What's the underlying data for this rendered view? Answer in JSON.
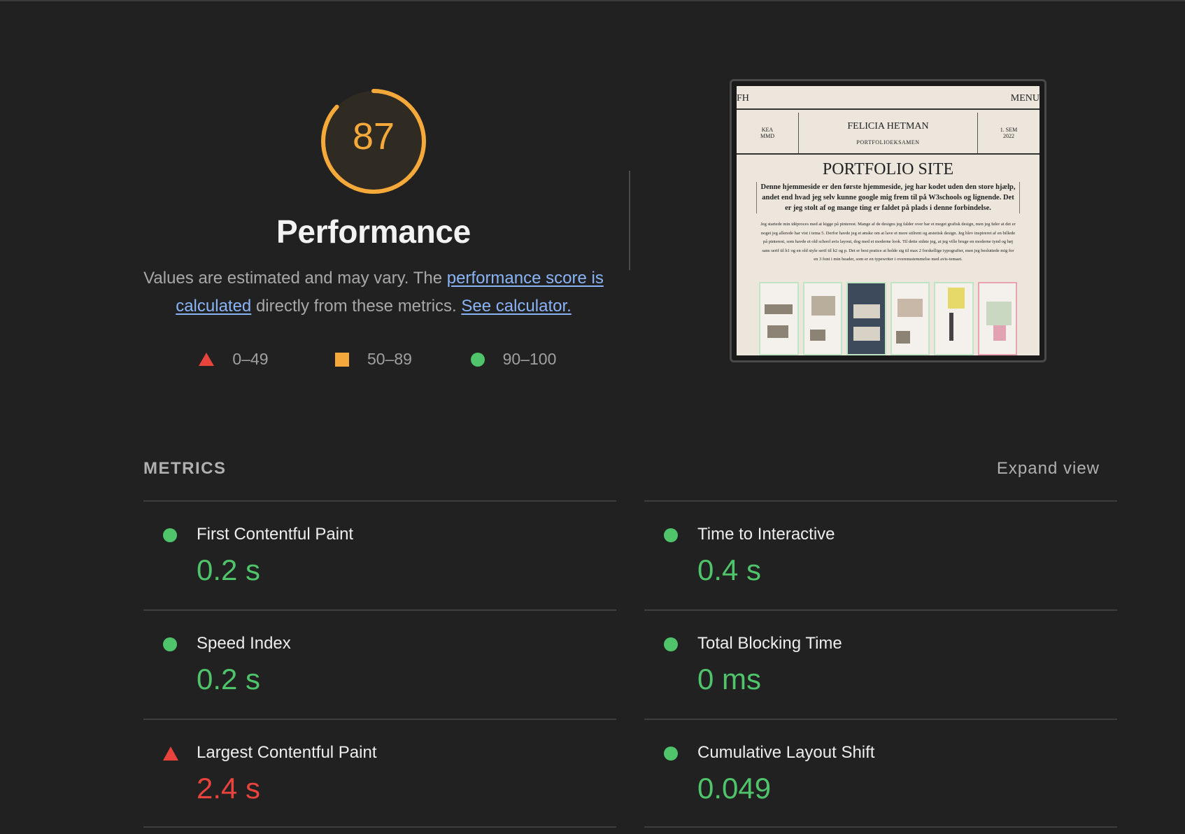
{
  "gauge": {
    "score": "87",
    "score_fraction": 0.87,
    "title": "Performance",
    "desc_prefix": "Values are estimated and may vary. The",
    "link_score": "performance score is calculated",
    "desc_middle": "directly from these metrics.",
    "link_calculator": "See calculator.",
    "color": "#f5a93a"
  },
  "legend": [
    {
      "shape": "triangle",
      "label": "0–49",
      "color": "#e8443d"
    },
    {
      "shape": "square",
      "label": "50–89",
      "color": "#f5a93a"
    },
    {
      "shape": "circle",
      "label": "90–100",
      "color": "#4fc46b"
    }
  ],
  "screenshot": {
    "nav_left": "FH",
    "nav_right": "MENU",
    "left_meta": "KEA\nMMD",
    "name": "FELICIA HETMAN",
    "subtitle": "PORTFOLIOEKSAMEN",
    "right_meta": "1. SEM\n2022",
    "title": "PORTFOLIO SITE",
    "lead": "Denne hjemmeside er den første hjemmeside, jeg har kodet uden den store hjælp, andet end hvad jeg selv kunne google mig frem til på W3schools og lignende. Det er jeg stolt af og mange ting er faldet på plads i denne forbindelse.",
    "body": "Jeg startede min idéproces med at kigge på pinterest. Mange af de designs jeg falder over har et meget grafisk design, men jeg føler at det er noget jeg allerede har vist i tema 5. Derfor havde jeg et ønske om at lave et mere stilrent og æstetisk design. Jeg blev inspireret af en billede på pinterest, som havde et old school avis layout, dog med et moderne look. Til dette sidste jeg, at jeg ville bruge en moderne tynd og høj sans serif til h1 og en old style serif til h2 og p. Det er best pratice at holde sig til max 2 forskellige typografier, men jeg besluttede mig for en 3 font i min header, som er en typewriter i overensstemmelse med avis-temaet."
  },
  "metrics": {
    "label": "METRICS",
    "expand_label": "Expand view",
    "items": [
      {
        "name": "First Contentful Paint",
        "value": "0.2 s",
        "status": "good"
      },
      {
        "name": "Time to Interactive",
        "value": "0.4 s",
        "status": "good"
      },
      {
        "name": "Speed Index",
        "value": "0.2 s",
        "status": "good"
      },
      {
        "name": "Total Blocking Time",
        "value": "0 ms",
        "status": "good"
      },
      {
        "name": "Largest Contentful Paint",
        "value": "2.4 s",
        "status": "bad"
      },
      {
        "name": "Cumulative Layout Shift",
        "value": "0.049",
        "status": "good"
      }
    ]
  }
}
